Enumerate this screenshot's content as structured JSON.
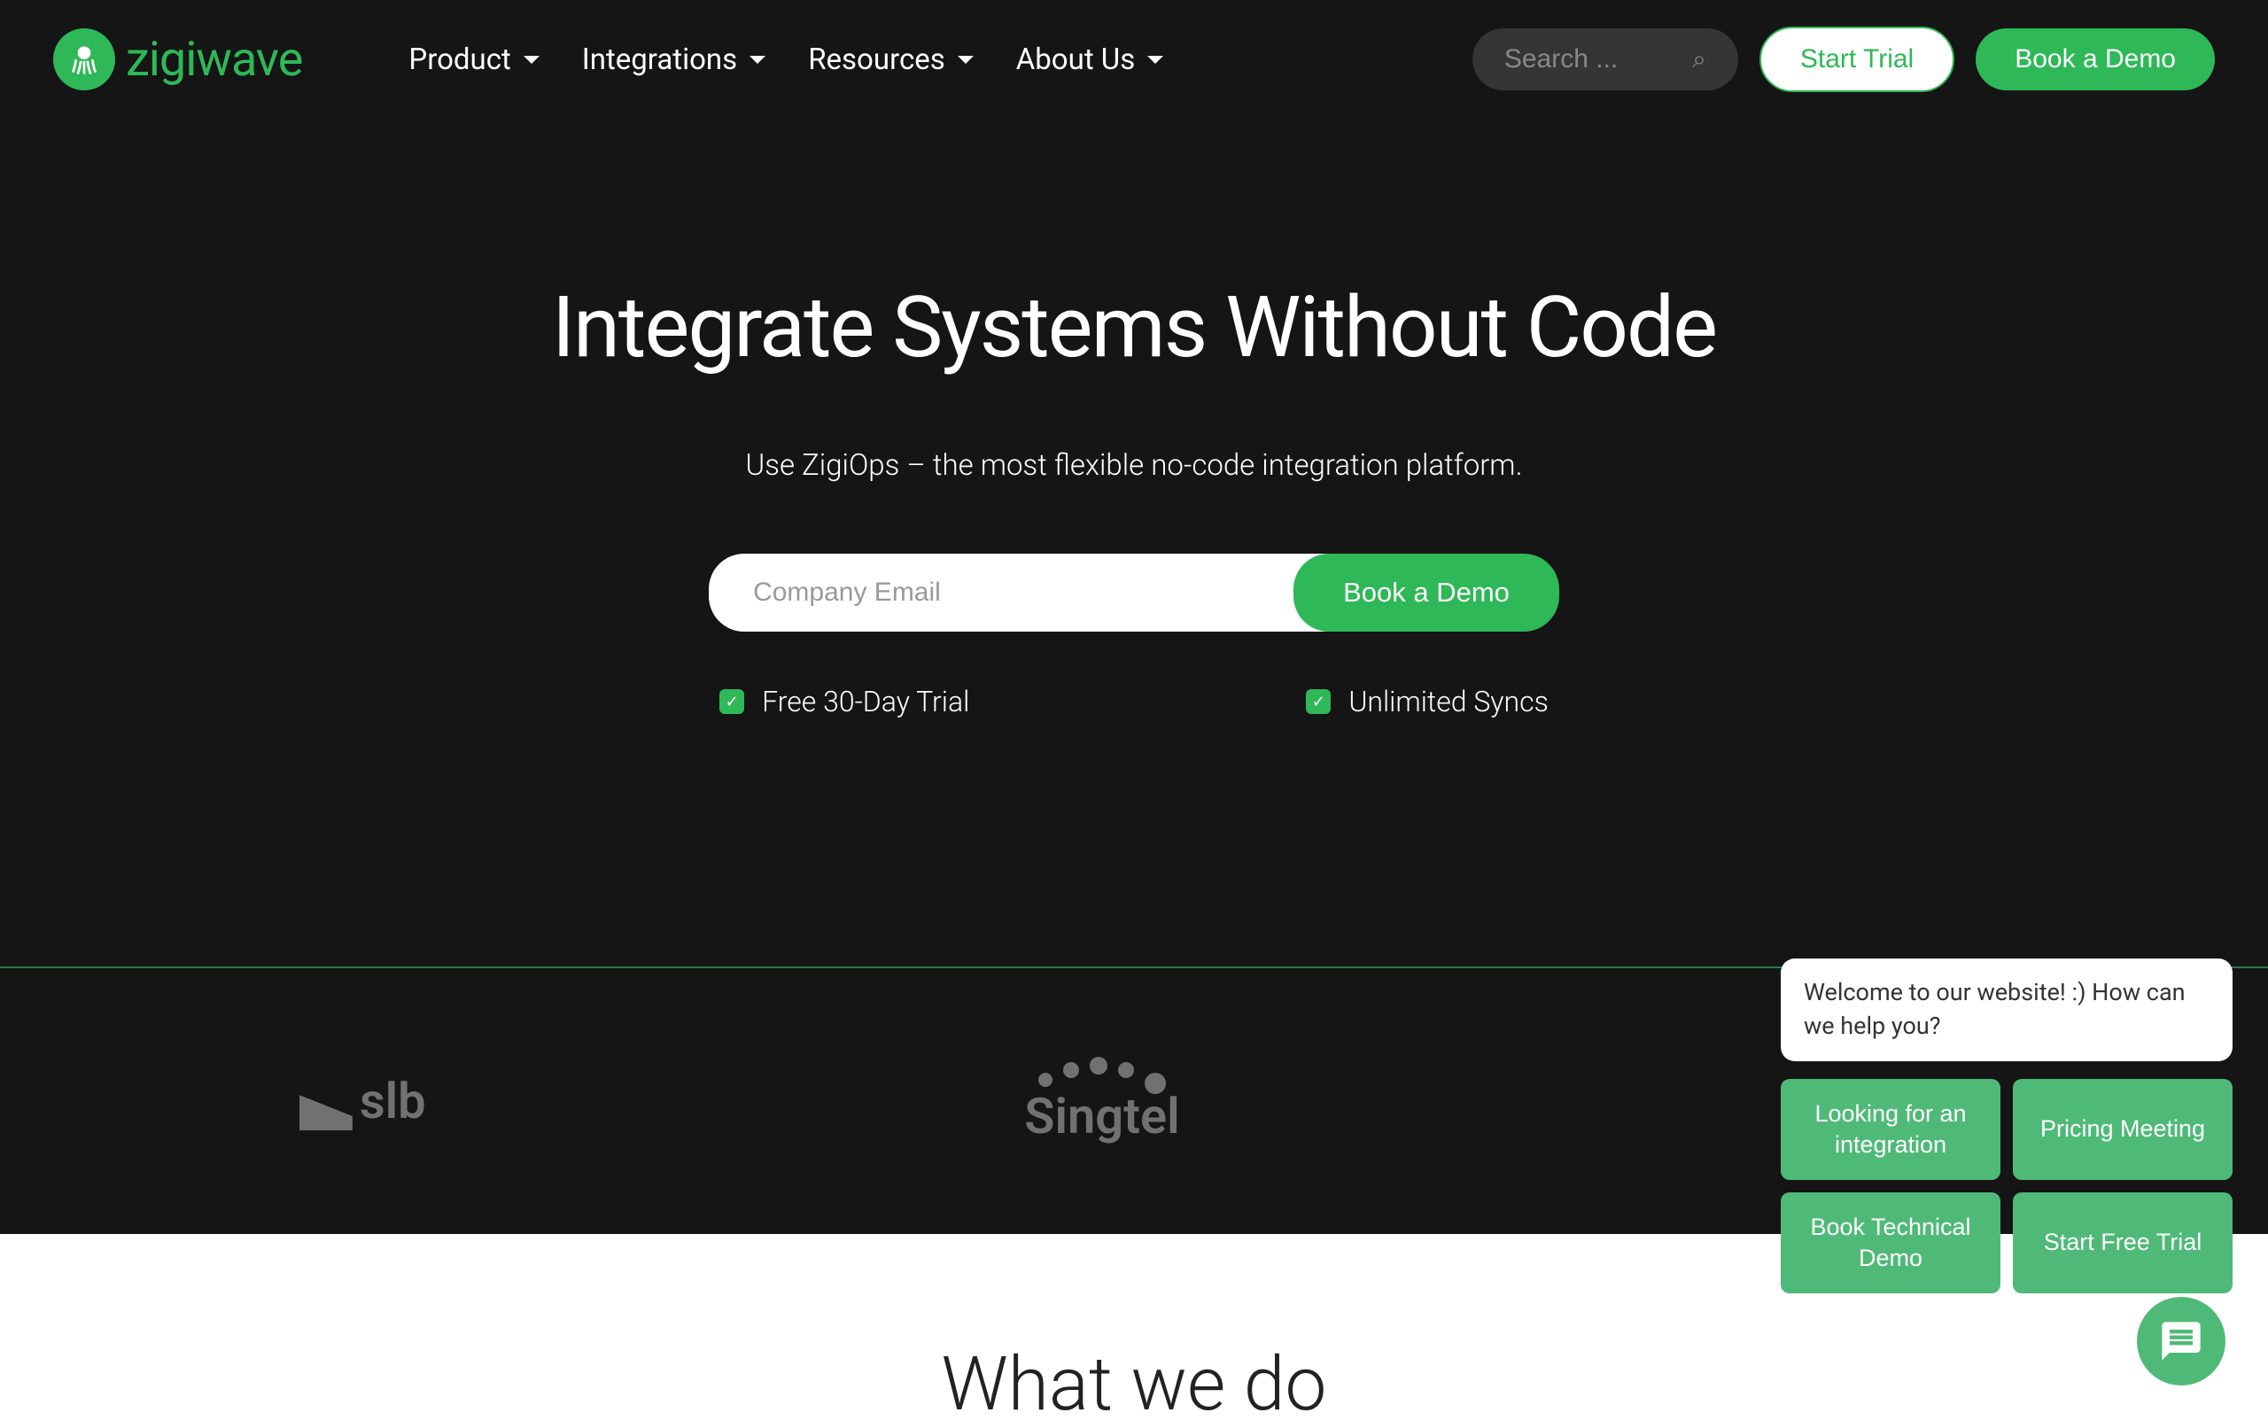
{
  "header": {
    "logo_text": "zigiwave",
    "nav": [
      {
        "label": "Product"
      },
      {
        "label": "Integrations"
      },
      {
        "label": "Resources"
      },
      {
        "label": "About Us"
      }
    ],
    "search_placeholder": "Search ...",
    "start_trial_label": "Start Trial",
    "book_demo_label": "Book a Demo"
  },
  "hero": {
    "title": "Integrate Systems Without Code",
    "subtitle": "Use ZigiOps – the most flexible no-code integration platform.",
    "email_placeholder": "Company Email",
    "email_button_label": "Book a Demo",
    "features": [
      {
        "label": "Free 30-Day Trial"
      },
      {
        "label": "Unlimited Syncs"
      }
    ]
  },
  "logos": {
    "items": [
      "slb",
      "Singtel",
      ""
    ]
  },
  "section2": {
    "heading": "What we do"
  },
  "chat": {
    "greeting": "Welcome to our website! :) How can we help you?",
    "options": [
      {
        "label": "Looking for an integration"
      },
      {
        "label": "Pricing Meeting"
      },
      {
        "label": "Book Technical Demo"
      },
      {
        "label": "Start Free Trial"
      }
    ]
  }
}
